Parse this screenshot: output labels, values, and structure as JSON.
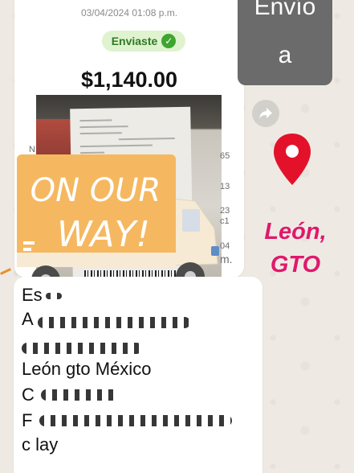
{
  "payment": {
    "datetime": "03/04/2024 01:08 p.m.",
    "status": "Enviaste",
    "amount": "$1,140.00",
    "photo_edge_left": "N",
    "photo_edge_right": [
      "65",
      "13",
      "23",
      "c1",
      "04",
      "m."
    ]
  },
  "sticker": {
    "line1": "ON OUR",
    "line2": "WAY!",
    "colors": {
      "box": "#f5b860",
      "text": "#ffffff",
      "truck": "#f6ead4"
    }
  },
  "side": {
    "envio_line1": "Envío",
    "envio_line2": "a",
    "city_line1": "León,",
    "city_line2": "GTO",
    "accent": "#e0186c",
    "pin_color": "#e3122a"
  },
  "address": {
    "lines": [
      "Es",
      "A",
      "",
      "León gto México",
      "C",
      "F",
      "c lay"
    ]
  },
  "icons": {
    "status": "check-icon",
    "share": "share-icon",
    "location": "location-pin-icon"
  }
}
